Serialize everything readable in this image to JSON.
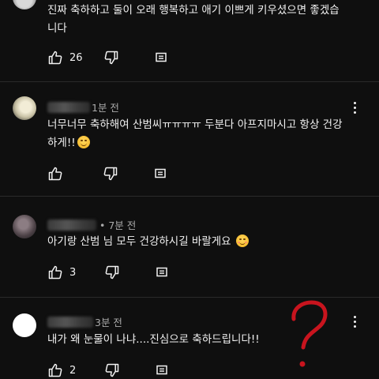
{
  "comments": [
    {
      "text_line1": "진짜 축하하고 둘이 오래 행복하고 애기 이쁘게 키우셨으면 좋겠습",
      "text_line2": "니다",
      "like_count": "26"
    },
    {
      "author_suffix": "1분 전",
      "text_line1": "너무너무 축하해여 산범씨ㅠㅠㅠㅠ 두분다 아프지마시고 항상 건강",
      "text_line2": "하게!!",
      "emoji": "smiling-face-icon",
      "like_count": ""
    },
    {
      "author_suffix": "• 7분 전",
      "text_line1": "아기랑 산범 님 모두 건강하시길 바랄게요",
      "emoji": "smiling-blush-face-icon",
      "like_count": "3"
    },
    {
      "author_suffix": "3분 전",
      "text_line1": "내가 왜 눈물이 나냐....진심으로 축하드립니다!!",
      "like_count": "2"
    }
  ],
  "annotation": {
    "symbol": "?",
    "color": "#c8141e"
  },
  "colors": {
    "background": "#0f0f0f",
    "text": "#f1f1f1",
    "secondary_text": "#aaaaaa"
  }
}
